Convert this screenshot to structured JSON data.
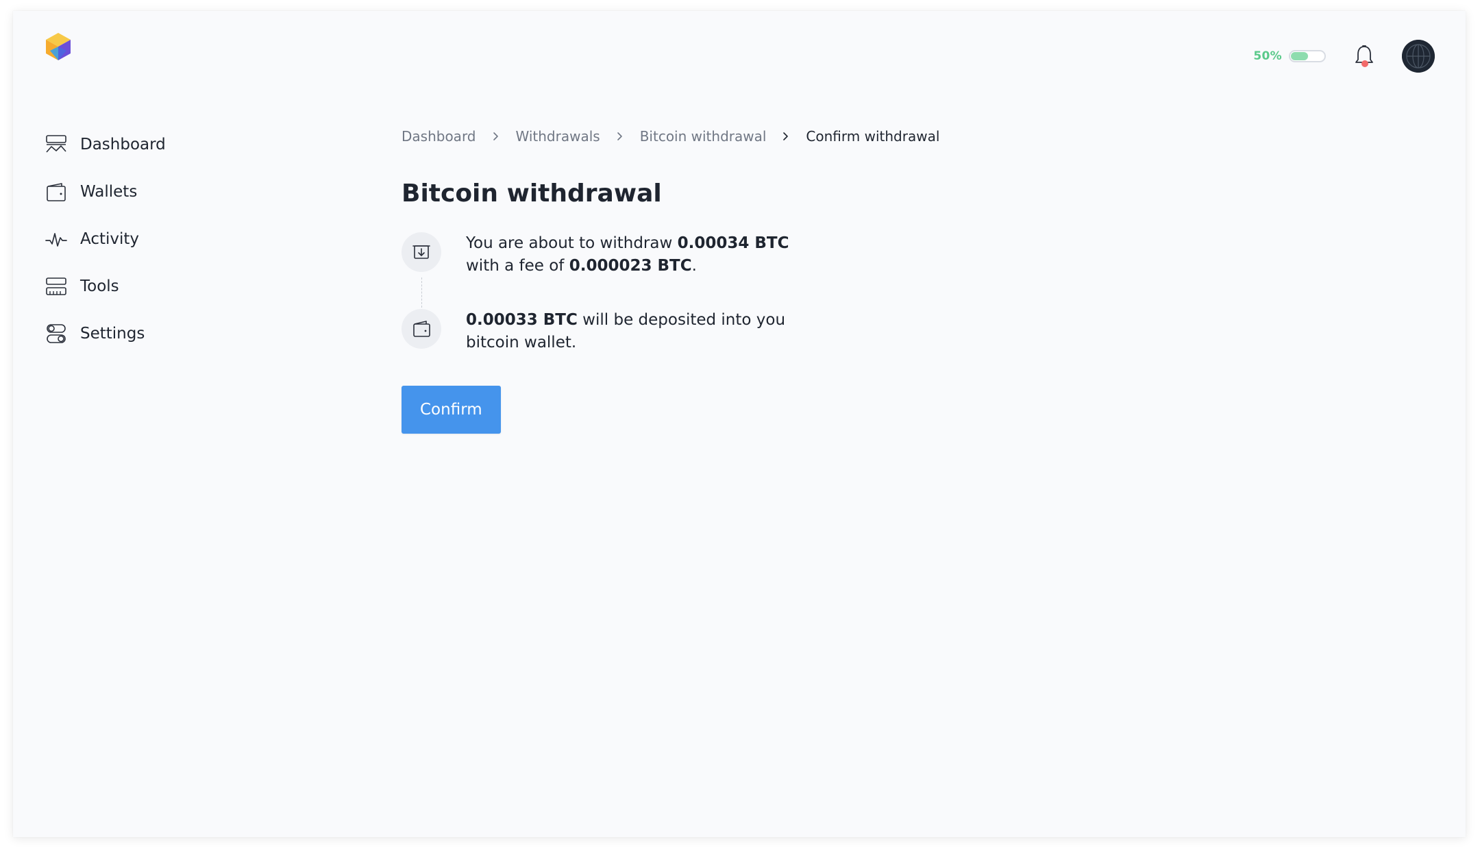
{
  "header": {
    "logo_icon": "cube-logo-icon",
    "percent": "50%",
    "toggle_level": 0.5,
    "accent_color": "#5ac98a",
    "notification_color": "#f26b6b",
    "bell_icon": "bell-icon",
    "avatar_icon": "globe-avatar"
  },
  "sidebar": {
    "items": [
      {
        "label": "Dashboard",
        "icon": "dashboard-icon"
      },
      {
        "label": "Wallets",
        "icon": "wallet-icon"
      },
      {
        "label": "Activity",
        "icon": "activity-icon"
      },
      {
        "label": "Tools",
        "icon": "tools-icon"
      },
      {
        "label": "Settings",
        "icon": "settings-icon"
      }
    ]
  },
  "breadcrumb": [
    "Dashboard",
    "Withdrawals",
    "Bitcoin withdrawal",
    "Confirm withdrawal"
  ],
  "main": {
    "title": "Bitcoin withdrawal",
    "steps": [
      {
        "icon": "withdraw-icon",
        "text_1": "You are about to withdraw ",
        "amount": "0.00034 BTC",
        "text_2": " with a fee of ",
        "fee": "0.000023 BTC",
        "text_3": "."
      },
      {
        "icon": "wallet-icon",
        "amount": "0.00033 BTC",
        "text": " will be deposited into you bitcoin wallet."
      }
    ],
    "confirm_label": "Confirm",
    "confirm_color": "#4594ec"
  }
}
